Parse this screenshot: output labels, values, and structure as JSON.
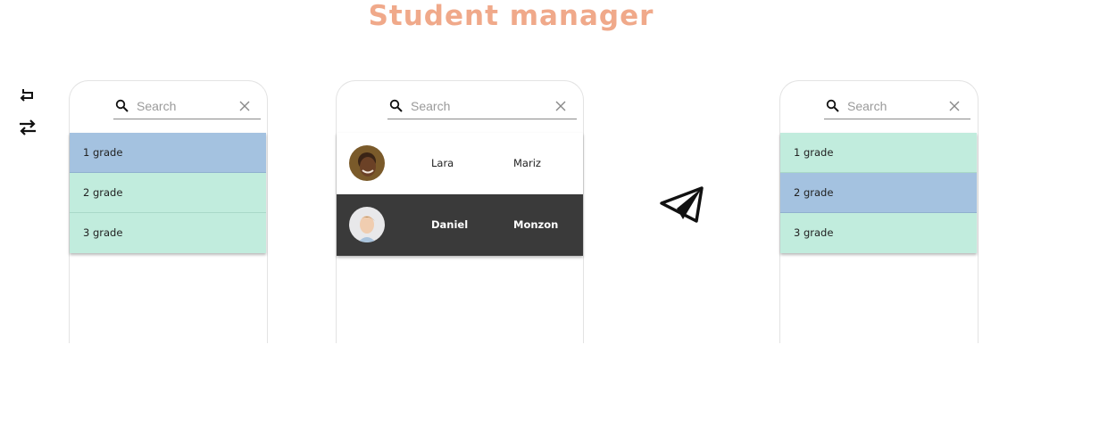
{
  "app": {
    "title": "Student manager"
  },
  "toolbar": {
    "back_icon": "return-arrow-icon",
    "swap_icon": "swap-arrows-icon"
  },
  "search": {
    "placeholder": "Search"
  },
  "left_panel": {
    "grades": [
      "1 grade",
      "2 grade",
      "3 grade"
    ],
    "selected": 0
  },
  "middle_panel": {
    "students": [
      {
        "first": "Lara",
        "last": "Mariz",
        "selected": false
      },
      {
        "first": "Daniel",
        "last": "Monzon",
        "selected": true
      }
    ]
  },
  "right_panel": {
    "grades": [
      "1 grade",
      "2 grade",
      "3 grade"
    ],
    "selected": 1
  },
  "action": {
    "send_icon": "paper-plane-icon"
  },
  "colors": {
    "title": "#F0A98A",
    "grade_bg": "#C1ECDD",
    "grade_selected": "#A4C2E0",
    "student_selected": "#3a3a3a"
  }
}
